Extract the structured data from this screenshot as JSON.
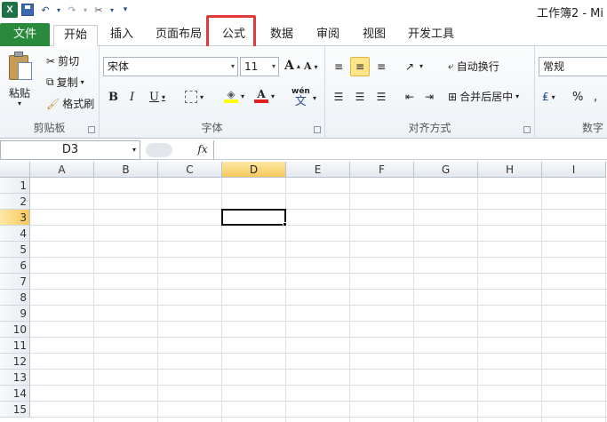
{
  "app": {
    "logo": "X",
    "title": "工作簿2 - Mi"
  },
  "qat": {
    "undo": "↶",
    "redo": "↷",
    "customize": "▾"
  },
  "tabs": {
    "file": "文件",
    "home": "开始",
    "insert": "插入",
    "page_layout": "页面布局",
    "formulas": "公式",
    "data": "数据",
    "review": "审阅",
    "view": "视图",
    "developer": "开发工具"
  },
  "ribbon": {
    "clipboard": {
      "label": "剪贴板",
      "paste": "粘贴",
      "cut": "剪切",
      "copy": "复制",
      "format_painter": "格式刷"
    },
    "font": {
      "label": "字体",
      "name": "宋体",
      "size": "11",
      "grow": "A",
      "shrink": "A",
      "bold": "B",
      "italic": "I",
      "underline": "U",
      "font_color": "A",
      "wen": "wén",
      "wen_char": "文"
    },
    "alignment": {
      "label": "对齐方式",
      "wrap_text": "自动换行",
      "merge_center": "合并后居中"
    },
    "number": {
      "label": "数字",
      "format": "常规",
      "percent": "%",
      "comma": ","
    }
  },
  "formula_bar": {
    "name_box": "D3",
    "fx": "fx"
  },
  "grid": {
    "columns": [
      "A",
      "B",
      "C",
      "D",
      "E",
      "F",
      "G",
      "H",
      "I"
    ],
    "rows": [
      "1",
      "2",
      "3",
      "4",
      "5",
      "6",
      "7",
      "8",
      "9",
      "10",
      "11",
      "12",
      "13",
      "14",
      "15"
    ],
    "active_column": "D",
    "active_row": "3"
  },
  "colors": {
    "file_tab": "#2a8a3b",
    "highlight_box": "#e03a3a",
    "active_header": "#f7c75a"
  }
}
